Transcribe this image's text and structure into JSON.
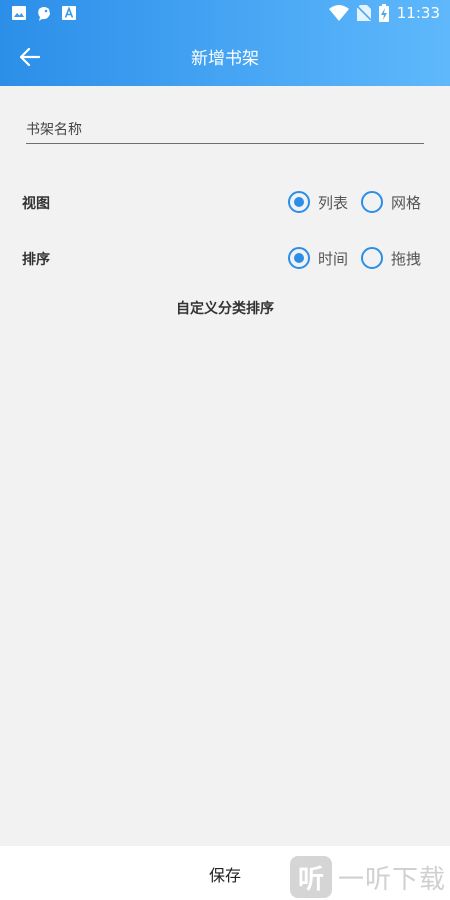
{
  "status_bar": {
    "time": "11:33",
    "left_icons": [
      "image-icon",
      "cloud-bird-icon",
      "font-a-icon"
    ],
    "right_icons": [
      "wifi-icon",
      "no-sim-icon",
      "battery-charging-icon"
    ]
  },
  "app_bar": {
    "title": "新增书架",
    "back_icon": "arrow-left-icon"
  },
  "form": {
    "name_placeholder": "书架名称",
    "name_value": "",
    "view": {
      "label": "视图",
      "options": [
        {
          "label": "列表",
          "checked": true
        },
        {
          "label": "网格",
          "checked": false
        }
      ]
    },
    "sort": {
      "label": "排序",
      "options": [
        {
          "label": "时间",
          "checked": true
        },
        {
          "label": "拖拽",
          "checked": false
        }
      ]
    },
    "custom_sort_label": "自定义分类排序"
  },
  "bottom": {
    "save_label": "保存"
  },
  "watermark": {
    "logo_char": "听",
    "text": "一听下载"
  },
  "colors": {
    "accent": "#2b8ee8",
    "header_end": "#5fb8fb",
    "background": "#f2f2f2"
  }
}
